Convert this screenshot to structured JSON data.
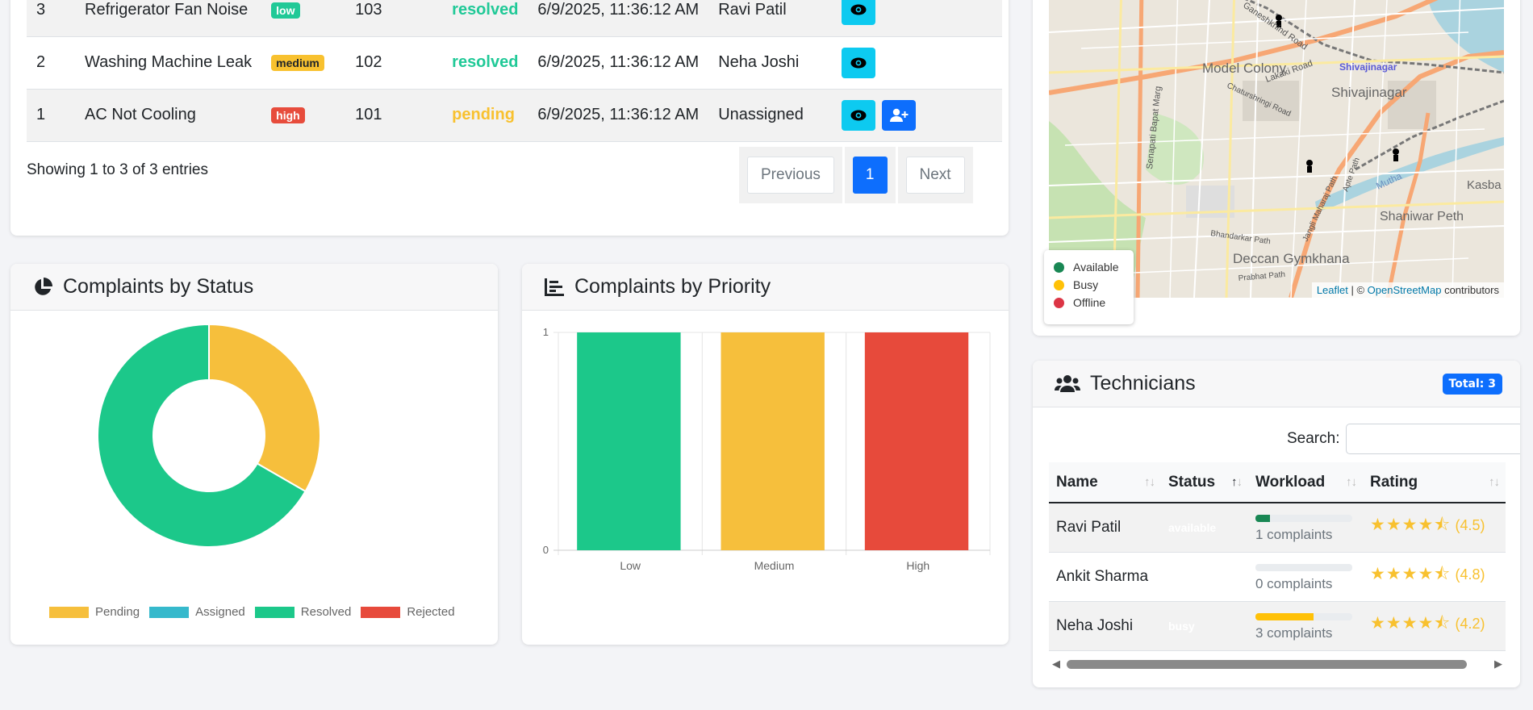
{
  "complaints": {
    "rows": [
      {
        "id": "3",
        "title": "Refrigerator Fan Noise",
        "priority": "low",
        "customer": "103",
        "status": "resolved",
        "date": "6/9/2025, 11:36:12 AM",
        "technician": "Ravi Patil"
      },
      {
        "id": "2",
        "title": "Washing Machine Leak",
        "priority": "medium",
        "customer": "102",
        "status": "resolved",
        "date": "6/9/2025, 11:36:12 AM",
        "technician": "Neha Joshi"
      },
      {
        "id": "1",
        "title": "AC Not Cooling",
        "priority": "high",
        "customer": "101",
        "status": "pending",
        "date": "6/9/2025, 11:36:12 AM",
        "technician": "Unassigned"
      }
    ],
    "showing": "Showing 1 to 3 of 3 entries",
    "pager": {
      "previous": "Previous",
      "page": "1",
      "next": "Next"
    }
  },
  "status_card": {
    "title": "Complaints by Status"
  },
  "priority_card": {
    "title": "Complaints by Priority"
  },
  "chart_data": [
    {
      "type": "pie",
      "title": "Complaints by Status",
      "categories": [
        "Pending",
        "Assigned",
        "Resolved",
        "Rejected"
      ],
      "values": [
        1,
        0,
        2,
        0
      ],
      "colors": [
        "#f6bf3c",
        "#36b9cc",
        "#1cc88a",
        "#e74a3b"
      ],
      "donut": true,
      "legend": "bottom"
    },
    {
      "type": "bar",
      "title": "Complaints by Priority",
      "categories": [
        "Low",
        "Medium",
        "High"
      ],
      "values": [
        1,
        1,
        1
      ],
      "colors": [
        "#1cc88a",
        "#f6bf3c",
        "#e74a3b"
      ],
      "ylim": [
        0,
        1
      ],
      "yticks": [
        "0",
        "1"
      ],
      "grid": true
    }
  ],
  "map": {
    "labels": [
      "Model Colony",
      "Shivajinagar",
      "Shivajinagar",
      "Deccan Gymkhana",
      "Shaniwar Peth",
      "Kasba",
      "Lakaki Road",
      "Chaturshringi Road",
      "Senapati Bapat Marg",
      "Ganeshkhind Road",
      "Bhandarkar Path",
      "Jangli Maharaj Path",
      "Apte Path",
      "Prabhat Path",
      "Mutha"
    ],
    "legend": [
      {
        "label": "Available",
        "color": "#198754"
      },
      {
        "label": "Busy",
        "color": "#ffc107"
      },
      {
        "label": "Offline",
        "color": "#dc3545"
      }
    ],
    "attribution_link1": "Leaflet",
    "attribution_sep": " | © ",
    "attribution_link2": "OpenStreetMap",
    "attribution_rest": " contributors"
  },
  "technicians": {
    "title": "Technicians",
    "total": "Total: 3",
    "search_label": "Search:",
    "columns": [
      "Name",
      "Status",
      "Workload",
      "Rating"
    ],
    "rows": [
      {
        "name": "Ravi Patil",
        "status": "available",
        "workload_fraction": 0.15,
        "workload_color": "#198754",
        "workload_text": "1 complaints",
        "stars": "★★★★⯪",
        "rating": "(4.5)"
      },
      {
        "name": "Ankit Sharma",
        "status": "",
        "workload_fraction": 0,
        "workload_color": "#198754",
        "workload_text": "0 complaints",
        "stars": "★★★★⯪",
        "rating": "(4.8)"
      },
      {
        "name": "Neha Joshi",
        "status": "busy",
        "workload_fraction": 0.6,
        "workload_color": "#ffc107",
        "workload_text": "3 complaints",
        "stars": "★★★★⯪",
        "rating": "(4.2)"
      }
    ]
  }
}
